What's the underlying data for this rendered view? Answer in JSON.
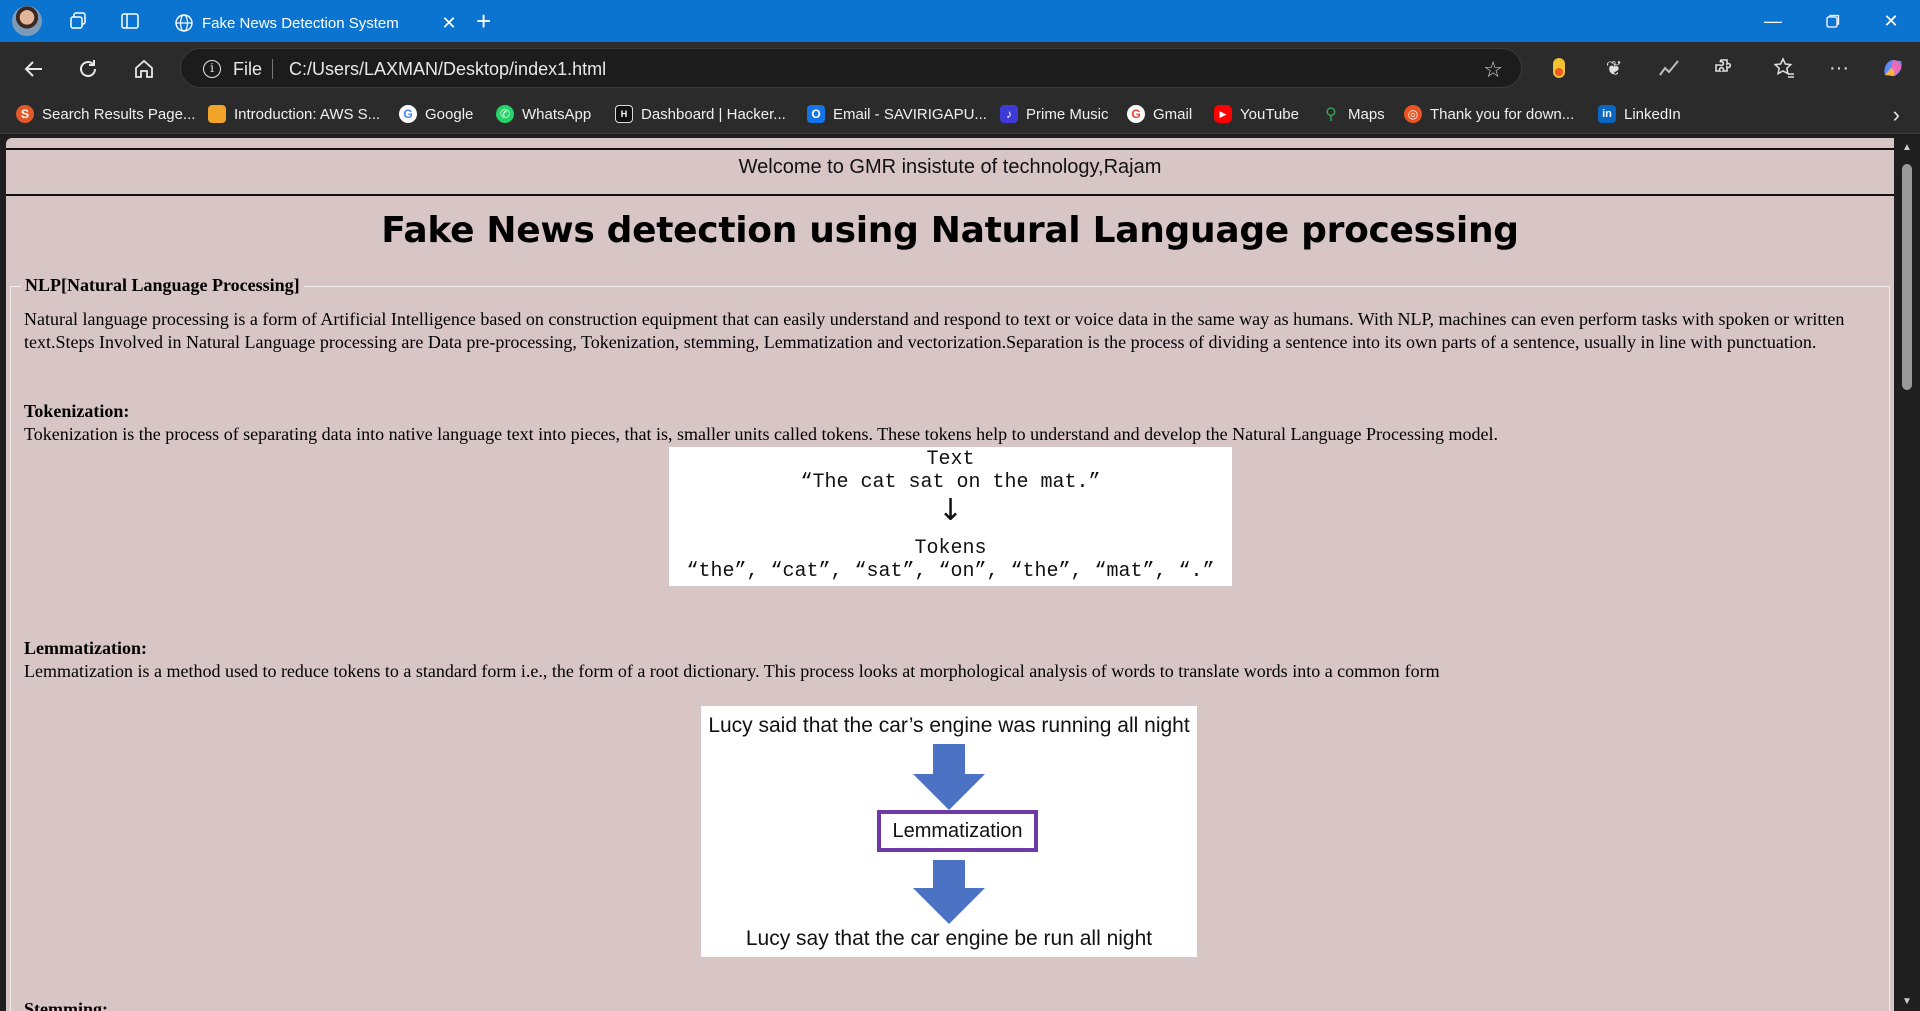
{
  "browser": {
    "tab_title": "Fake News Detection System",
    "address": {
      "scheme_label": "File",
      "url": "C:/Users/LAXMAN/Desktop/index1.html"
    },
    "bookmarks": [
      {
        "label": "Search Results Page...",
        "icon": "search-results-icon",
        "color": "#e25a2a"
      },
      {
        "label": "Introduction: AWS S...",
        "icon": "aws-icon",
        "color": "#f0a42a"
      },
      {
        "label": "Google",
        "icon": "google-icon",
        "color": "#ffffff"
      },
      {
        "label": "WhatsApp",
        "icon": "whatsapp-icon",
        "color": "#25d366"
      },
      {
        "label": "Dashboard | Hacker...",
        "icon": "hackerrank-icon",
        "color": "#111111"
      },
      {
        "label": "Email - SAVIRIGAPU...",
        "icon": "outlook-icon",
        "color": "#1473e6"
      },
      {
        "label": "Prime Music",
        "icon": "prime-music-icon",
        "color": "#3d3bd6"
      },
      {
        "label": "Gmail",
        "icon": "gmail-icon",
        "color": "#ffffff"
      },
      {
        "label": "YouTube",
        "icon": "youtube-icon",
        "color": "#ff0000"
      },
      {
        "label": "Maps",
        "icon": "maps-icon",
        "color": "#34a853"
      },
      {
        "label": "Thank you for down...",
        "icon": "ubuntu-icon",
        "color": "#e95420"
      },
      {
        "label": "LinkedIn",
        "icon": "linkedin-icon",
        "color": "#0a66c2"
      }
    ],
    "colors": {
      "titlebar": "#0b74d1",
      "toolbar": "#2b2b2b",
      "page_background": "#d8c5c6"
    }
  },
  "page": {
    "welcome": "Welcome to GMR insistute of technology,Rajam",
    "title": "Fake News detection using Natural Language processing",
    "section_legend": "NLP[Natural Language Processing]",
    "intro": "Natural language processing is a form of Artificial Intelligence based on construction equipment that can easily understand and respond to text or voice data in the same way as humans. With NLP, machines can even perform tasks with spoken or written text.Steps Involved in Natural Language processing are Data pre-processing, Tokenization, stemming, Lemmatization and vectorization.Separation is the process of dividing a sentence into its own parts of a sentence, usually in line with punctuation.",
    "tokenization": {
      "heading": "Tokenization:",
      "text": "Tokenization is the process of separating data into native language text into pieces, that is, smaller units called tokens. These tokens help to understand and develop the Natural Language Processing model.",
      "figure": {
        "label_text": "Text",
        "sentence": "“The cat sat on the mat.”",
        "label_tokens": "Tokens",
        "tokens": "“the”, “cat”, “sat”, “on”, “the”, “mat”, “.”"
      }
    },
    "lemmatization": {
      "heading": "Lemmatization:",
      "text": "Lemmatization is a method used to reduce tokens to a standard form i.e., the form of a root dictionary. This process looks at morphological analysis of words to translate words into a common form",
      "figure": {
        "input": "Lucy said that the car’s engine was running all night",
        "step": "Lemmatization",
        "output": "Lucy say that the car engine be run all night"
      }
    },
    "next_heading": "Stemming:"
  }
}
